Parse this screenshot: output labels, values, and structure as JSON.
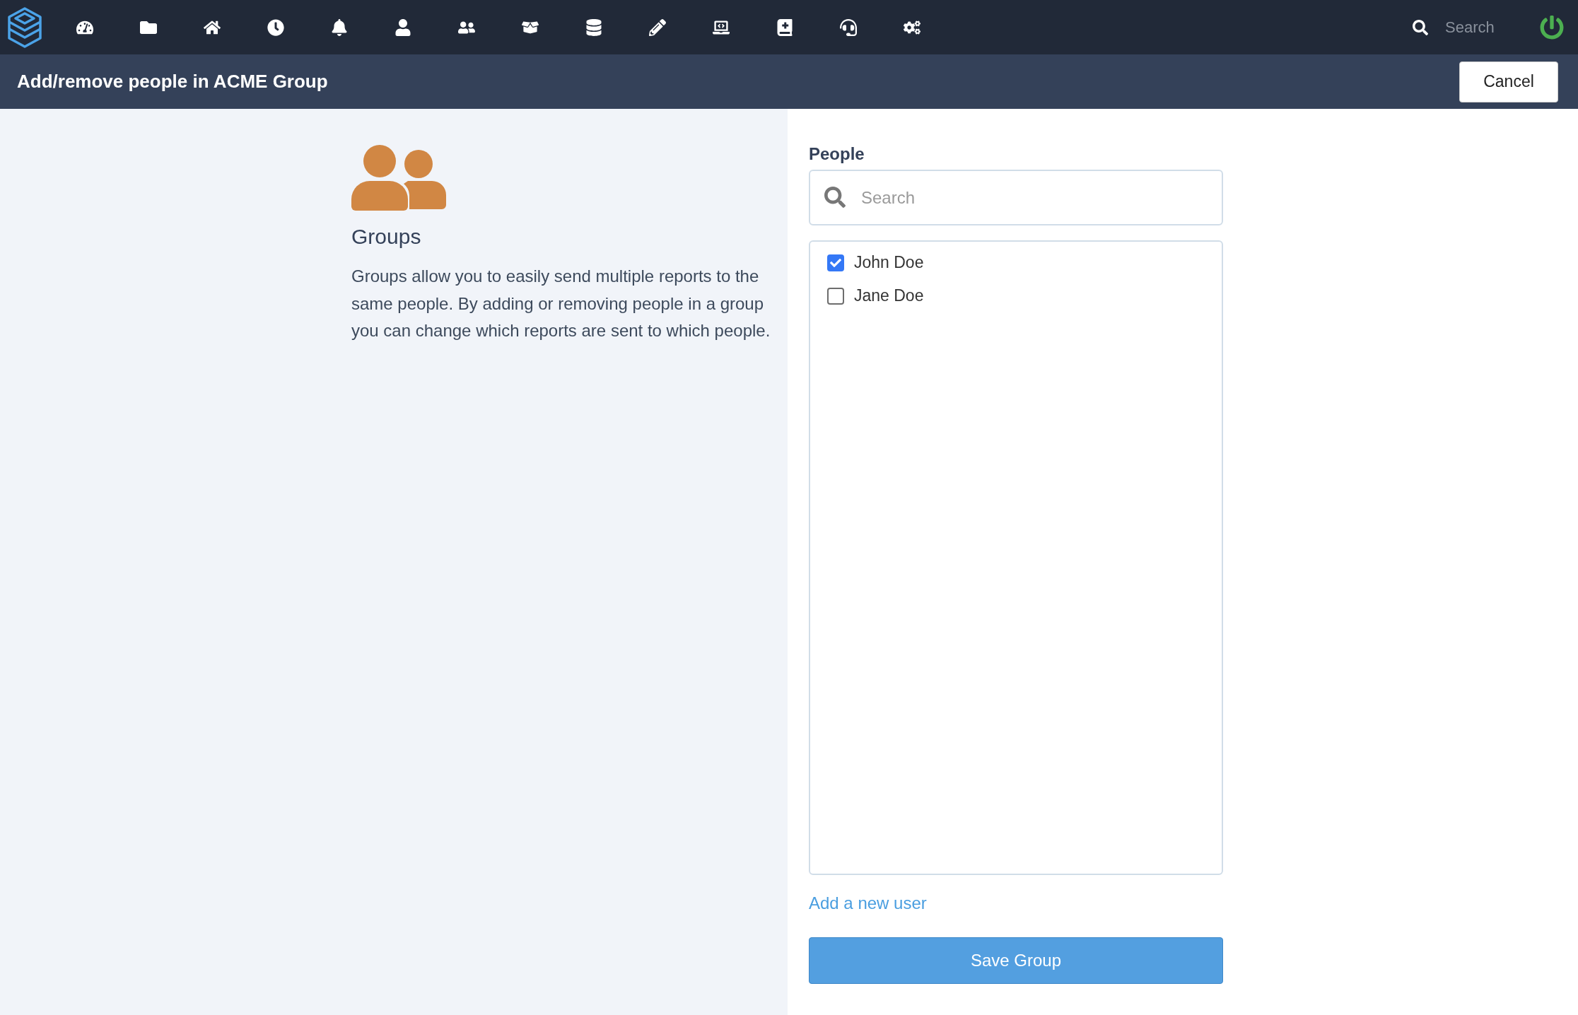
{
  "topbar": {
    "search": {
      "placeholder": "Search"
    }
  },
  "header": {
    "title": "Add/remove people in ACME Group",
    "cancel_button": "Cancel"
  },
  "info": {
    "title": "Groups",
    "description": "Groups allow you to easily send multiple reports to the same people. By adding or removing people in a group you can change which reports are sent to which people."
  },
  "people": {
    "label": "People",
    "search": {
      "placeholder": "Search"
    },
    "items": [
      {
        "name": "John Doe",
        "checked": true
      },
      {
        "name": "Jane Doe",
        "checked": false
      }
    ],
    "add_link": "Add a new user",
    "save_button": "Save Group"
  }
}
